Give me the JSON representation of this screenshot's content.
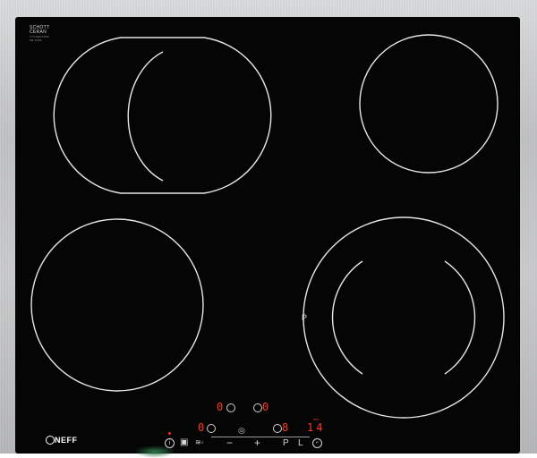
{
  "brand": {
    "glass_line1": "SCHOTT",
    "glass_line2": "CERAN",
    "glass_small1": "TTGSEP0068",
    "glass_small2": "SB-5056",
    "logo_text": "NEFF"
  },
  "zones": {
    "rear_right_mark": "",
    "front_right_letter": "P"
  },
  "display": {
    "rear_left_level": "0",
    "rear_right_level": "0",
    "front_left_level": "0",
    "front_right_level": "8",
    "timer_value": "14",
    "timer_unit": "min"
  },
  "controls": {
    "power_icon": "power-icon",
    "child_lock_icon": "lock-icon",
    "keep_warm_icon": "keep-warm-icon",
    "minus_label": "−",
    "zone_select_icon": "zone-select-icon",
    "plus_label": "+",
    "powerboost_label": "P",
    "lock_label": "L",
    "timer_icon": "clock-icon"
  },
  "colors": {
    "glass": "#050505",
    "zone_outline": "#e6e6e6",
    "display_red": "#ff3a22",
    "frame_steel": "#c4c5c7"
  }
}
